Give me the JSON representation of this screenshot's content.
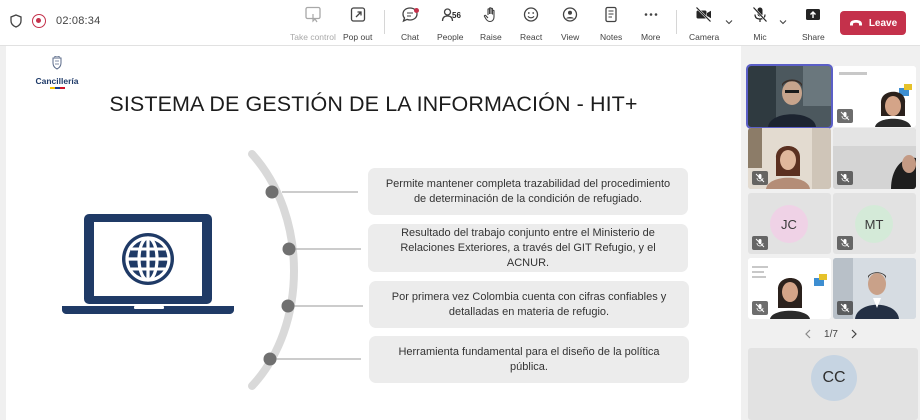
{
  "meeting": {
    "timer": "02:08:34",
    "people_count": "56"
  },
  "toolbar": {
    "take_control": "Take control",
    "pop_out": "Pop out",
    "chat": "Chat",
    "people": "People",
    "raise": "Raise",
    "react": "React",
    "view": "View",
    "notes": "Notes",
    "more": "More",
    "camera": "Camera",
    "mic": "Mic",
    "share": "Share",
    "leave": "Leave"
  },
  "slide": {
    "logo_text": "Cancillería",
    "title": "SISTEMA DE GESTIÓN DE LA INFORMACIÓN - HIT+",
    "bullets": [
      "Permite mantener completa trazabilidad del procedimiento de determinación de la condición de refugiado.",
      "Resultado del trabajo conjunto entre el Ministerio de Relaciones Exteriores, a través del GIT Refugio, y el ACNUR.",
      "Por primera vez Colombia cuenta con cifras confiables y detalladas en materia de refugio.",
      "Herramienta fundamental para el diseño de la política pública."
    ]
  },
  "participants": {
    "tiles": [
      {
        "initials": ""
      },
      {
        "initials": ""
      },
      {
        "initials": ""
      },
      {
        "initials": ""
      },
      {
        "initials": "JC"
      },
      {
        "initials": "MT"
      },
      {
        "initials": ""
      },
      {
        "initials": ""
      }
    ],
    "page": "1/7",
    "large_avatar": "CC"
  },
  "colors": {
    "accent": "#5b5fc7",
    "leave": "#c4314b",
    "slide_navy": "#1f3a66",
    "box_bg": "#ececec"
  }
}
